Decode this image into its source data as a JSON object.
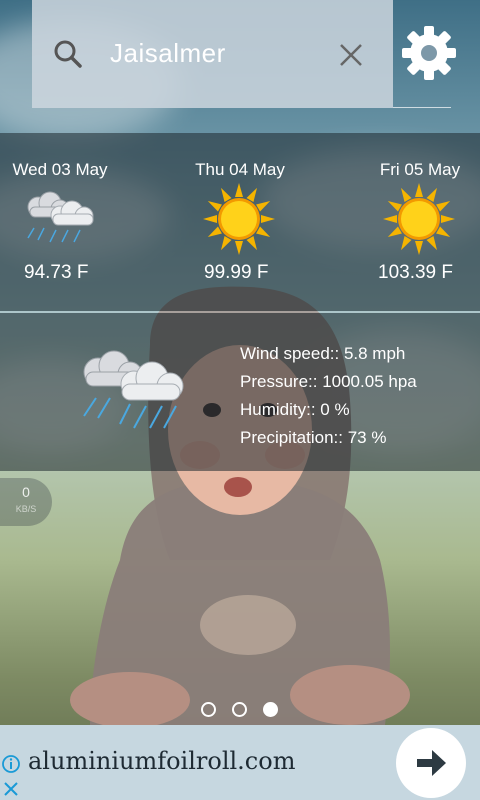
{
  "search": {
    "city": "Jaisalmer"
  },
  "forecast": [
    {
      "date": "Wed 03 May",
      "icon": "rain-cloud-icon",
      "temp": "94.73 F"
    },
    {
      "date": "Thu 04 May",
      "icon": "sun-icon",
      "temp": "99.99 F"
    },
    {
      "date": "Fri 05 May",
      "icon": "sun-icon",
      "temp": "103.39 F"
    }
  ],
  "current": {
    "icon": "rain-cloud-icon",
    "wind": "Wind speed:: 5.8 mph",
    "pressure": "Pressure:: 1000.05 hpa",
    "humidity": "Humidity:: 0 %",
    "precipitation": "Precipitation:: 73 %"
  },
  "speed_badge": {
    "value": "0",
    "unit": "KB/S"
  },
  "pager": {
    "pages": 3,
    "active": 3
  },
  "ad": {
    "text": "aluminiumfoilroll.com"
  },
  "colors": {
    "sun": "#f5c400",
    "overlay": "#1e282d",
    "ad_bg": "#c6d7e0"
  }
}
